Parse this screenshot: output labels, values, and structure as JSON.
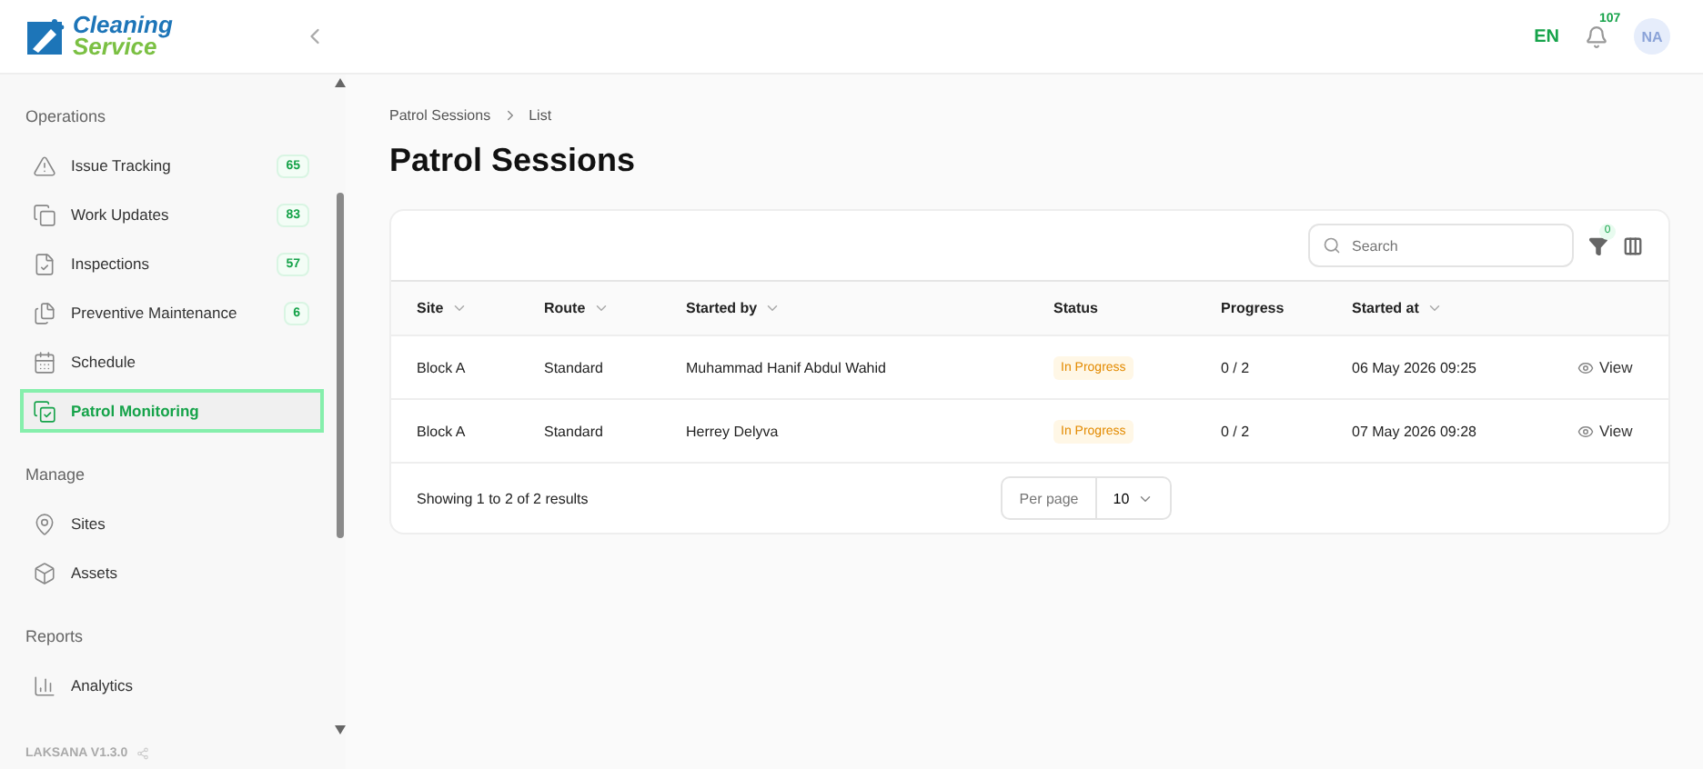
{
  "logo": {
    "line_1": "Cleaning",
    "line_2": "Service"
  },
  "topbar": {
    "language": "EN",
    "notifications": "107",
    "avatar": "NA"
  },
  "sidebar": {
    "sections": [
      {
        "title": "Operations",
        "items": [
          {
            "label": "Issue Tracking",
            "badge": "65",
            "selected": false
          },
          {
            "label": "Work Updates",
            "badge": "83",
            "selected": false
          },
          {
            "label": "Inspections",
            "badge": "57",
            "selected": false
          },
          {
            "label": "Preventive Maintenance",
            "badge": "6",
            "selected": false
          },
          {
            "label": "Schedule",
            "selected": false
          },
          {
            "label": "Patrol Monitoring",
            "selected": true
          }
        ]
      },
      {
        "title": "Manage",
        "items": [
          {
            "label": "Sites",
            "selected": false
          },
          {
            "label": "Assets",
            "selected": false
          }
        ]
      },
      {
        "title": "Reports",
        "items": [
          {
            "label": "Analytics",
            "selected": false
          }
        ]
      }
    ],
    "version": "LAKSANA V1.3.0"
  },
  "breadcrumb": [
    "Patrol Sessions",
    "List"
  ],
  "page_title": "Patrol Sessions",
  "toolbar": {
    "search": {
      "placeholder": "Search"
    },
    "filter_count": "0"
  },
  "table": {
    "columns": [
      {
        "label": "Site",
        "sortable": true
      },
      {
        "label": "Route",
        "sortable": true
      },
      {
        "label": "Started by",
        "sortable": true
      },
      {
        "label": "Status",
        "sortable": false
      },
      {
        "label": "Progress",
        "sortable": false
      },
      {
        "label": "Started at",
        "sortable": true
      }
    ],
    "rows": [
      {
        "site": "Block A",
        "route": "Standard",
        "started_by": "Muhammad Hanif Abdul Wahid",
        "status": "In Progress",
        "progress": "0 / 2",
        "started_at": "06 May 2026 09:25",
        "action": "View"
      },
      {
        "site": "Block A",
        "route": "Standard",
        "started_by": "Herrey Delyva",
        "status": "In Progress",
        "progress": "0 / 2",
        "started_at": "07 May 2026 09:28",
        "action": "View"
      }
    ]
  },
  "footer": {
    "summary": "Showing 1 to 2 of 2 results",
    "per_page_label": "Per page",
    "per_page_value": "10"
  }
}
